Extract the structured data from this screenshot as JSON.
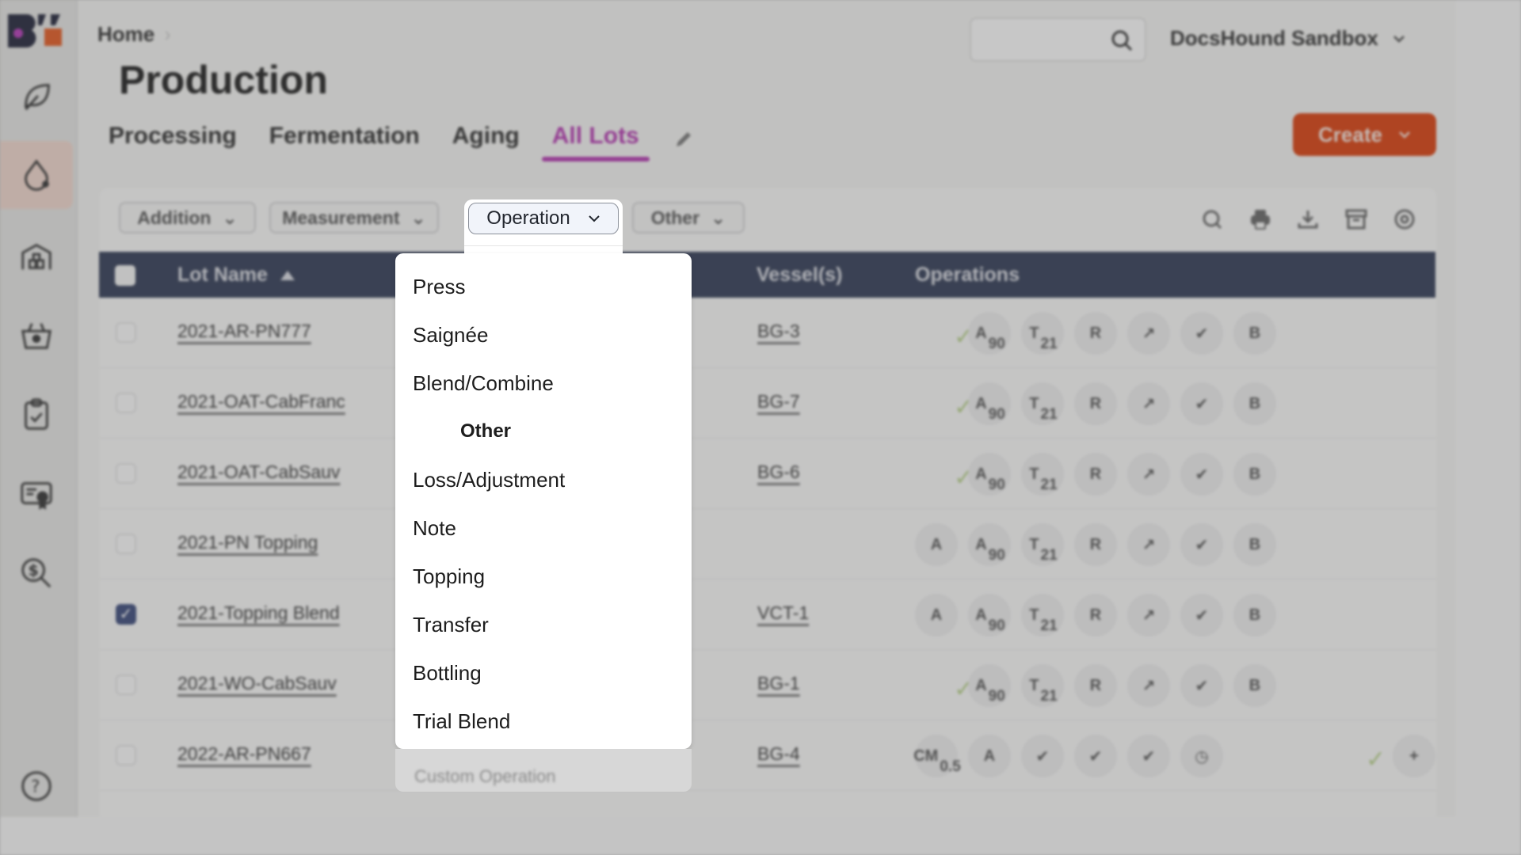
{
  "sidebar": {
    "logo": "BV logo",
    "items": [
      {
        "icon": "leaf-icon",
        "label": "Vineyard"
      },
      {
        "icon": "drop-icon",
        "label": "Production",
        "active": true
      },
      {
        "icon": "warehouse-icon",
        "label": "Inventory"
      },
      {
        "icon": "basket-icon",
        "label": "Harvest"
      },
      {
        "icon": "clipboard-check-icon",
        "label": "Tasks"
      },
      {
        "icon": "certificate-icon",
        "label": "Compliance"
      },
      {
        "icon": "cost-search-icon",
        "label": "Costing"
      }
    ],
    "help_icon": "help-icon"
  },
  "header": {
    "breadcrumb": [
      "Home"
    ],
    "breadcrumb_sep": "›",
    "title": "Production",
    "search_placeholder": "",
    "org_name": "DocsHound Sandbox",
    "create_label": "Create"
  },
  "tabs": [
    {
      "label": "Processing"
    },
    {
      "label": "Fermentation"
    },
    {
      "label": "Aging"
    },
    {
      "label": "All Lots",
      "active": true
    }
  ],
  "filters": [
    {
      "label": "Addition"
    },
    {
      "label": "Measurement"
    },
    {
      "label": "Operation",
      "open": true
    },
    {
      "label": "Other"
    }
  ],
  "toolbar_icons": [
    "search-icon",
    "print-icon",
    "download-icon",
    "archive-icon",
    "settings-icon"
  ],
  "table": {
    "columns": [
      "Lot Name",
      "Vessel(s)",
      "Operations"
    ],
    "sort": {
      "column": "Lot Name",
      "direction": "ascending"
    },
    "rows": [
      {
        "lot": "2021-AR-PN777",
        "vessel": "BG-3",
        "checked": false,
        "done": true,
        "ops": [
          {
            "g": "A",
            "s": "90"
          },
          {
            "g": "T",
            "s": "21"
          },
          {
            "g": "R",
            "s": ""
          },
          {
            "g": "↗",
            "s": ""
          },
          {
            "g": "✔",
            "s": ""
          },
          {
            "g": "B",
            "s": ""
          }
        ]
      },
      {
        "lot": "2021-OAT-CabFranc",
        "vessel": "BG-7",
        "checked": false,
        "done": true,
        "ops": [
          {
            "g": "A",
            "s": "90"
          },
          {
            "g": "T",
            "s": "21"
          },
          {
            "g": "R",
            "s": ""
          },
          {
            "g": "↗",
            "s": ""
          },
          {
            "g": "✔",
            "s": ""
          },
          {
            "g": "B",
            "s": ""
          }
        ]
      },
      {
        "lot": "2021-OAT-CabSauv",
        "vessel": "BG-6",
        "checked": false,
        "done": true,
        "ops": [
          {
            "g": "A",
            "s": "90"
          },
          {
            "g": "T",
            "s": "21"
          },
          {
            "g": "R",
            "s": ""
          },
          {
            "g": "↗",
            "s": ""
          },
          {
            "g": "✔",
            "s": ""
          },
          {
            "g": "B",
            "s": ""
          }
        ]
      },
      {
        "lot": "2021-PN Topping",
        "vessel": "",
        "checked": false,
        "done": false,
        "lead": "A",
        "ops": [
          {
            "g": "A",
            "s": "90"
          },
          {
            "g": "T",
            "s": "21"
          },
          {
            "g": "R",
            "s": ""
          },
          {
            "g": "↗",
            "s": ""
          },
          {
            "g": "✔",
            "s": ""
          },
          {
            "g": "B",
            "s": ""
          }
        ]
      },
      {
        "lot": "2021-Topping Blend",
        "vessel": "VCT-1",
        "checked": true,
        "done": false,
        "lead": "A",
        "ops": [
          {
            "g": "A",
            "s": "90"
          },
          {
            "g": "T",
            "s": "21"
          },
          {
            "g": "R",
            "s": ""
          },
          {
            "g": "↗",
            "s": ""
          },
          {
            "g": "✔",
            "s": ""
          },
          {
            "g": "B",
            "s": ""
          }
        ]
      },
      {
        "lot": "2021-WO-CabSauv",
        "vessel": "BG-1",
        "checked": false,
        "done": true,
        "ops": [
          {
            "g": "A",
            "s": "90"
          },
          {
            "g": "T",
            "s": "21"
          },
          {
            "g": "R",
            "s": ""
          },
          {
            "g": "↗",
            "s": ""
          },
          {
            "g": "✔",
            "s": ""
          },
          {
            "g": "B",
            "s": ""
          }
        ]
      },
      {
        "lot": "2022-AR-PN667",
        "vessel": "BG-4",
        "checked": false,
        "done": false,
        "alt": true,
        "ops": [
          {
            "g": "CM",
            "s": "0.5"
          },
          {
            "g": "A",
            "s": ""
          },
          {
            "g": "✔",
            "s": ""
          },
          {
            "g": "✔",
            "s": ""
          },
          {
            "g": "✔",
            "s": ""
          },
          {
            "g": "◷",
            "s": ""
          }
        ],
        "tail_done": true,
        "tail": "+"
      }
    ]
  },
  "operation_menu": {
    "button_label": "Operation",
    "items": [
      {
        "type": "item",
        "label": "Press"
      },
      {
        "type": "item",
        "label": "Saignée"
      },
      {
        "type": "item",
        "label": "Blend/Combine"
      },
      {
        "type": "group",
        "label": "Other"
      },
      {
        "type": "item",
        "label": "Loss/Adjustment"
      },
      {
        "type": "item",
        "label": "Note"
      },
      {
        "type": "item",
        "label": "Topping"
      },
      {
        "type": "item",
        "label": "Transfer"
      },
      {
        "type": "item",
        "label": "Bottling"
      },
      {
        "type": "item",
        "label": "Trial Blend"
      }
    ],
    "below_hint": "Custom Operation"
  },
  "colors": {
    "accent": "#b338b0",
    "create": "#d9400f",
    "table_header": "#323c56",
    "sidebar_active": "#f0d6cc",
    "done_check": "#b7d08b"
  }
}
